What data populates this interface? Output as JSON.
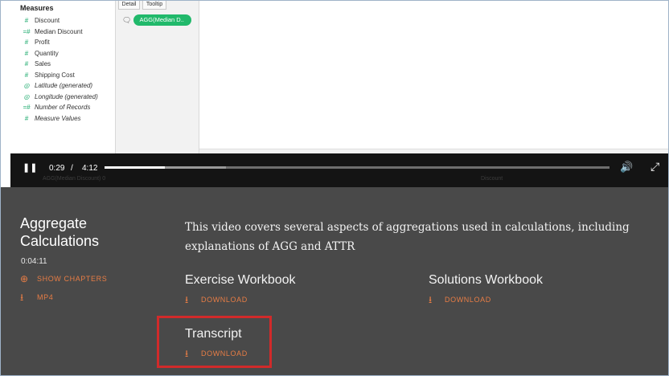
{
  "tableau": {
    "measures_heading": "Measures",
    "measures": [
      {
        "label": "Discount",
        "icon": "#",
        "italic": false
      },
      {
        "label": "Median Discount",
        "icon": "=#",
        "italic": false
      },
      {
        "label": "Profit",
        "icon": "#",
        "italic": false
      },
      {
        "label": "Quantity",
        "icon": "#",
        "italic": false
      },
      {
        "label": "Sales",
        "icon": "#",
        "italic": false
      },
      {
        "label": "Shipping Cost",
        "icon": "#",
        "italic": false
      },
      {
        "label": "Latitude (generated)",
        "icon": "globe",
        "italic": true
      },
      {
        "label": "Longitude (generated)",
        "icon": "globe",
        "italic": true
      },
      {
        "label": "Number of Records",
        "icon": "=#",
        "italic": true
      },
      {
        "label": "Measure Values",
        "icon": "#",
        "italic": true
      }
    ],
    "marks_buttons": [
      "Detail",
      "Tooltip"
    ],
    "pill_label": "AGG(Median D..",
    "bottom_ghost": "AGG(Median Discount) 0",
    "bottom_ghost_right": "Discount"
  },
  "player": {
    "current_time": "0:29",
    "separator": "/",
    "total_time": "4:12",
    "progress_played": 0.12,
    "progress_buffered": 0.24
  },
  "video_info": {
    "title": "Aggregate Calculations",
    "duration": "0:04:11",
    "show_chapters": "SHOW CHAPTERS",
    "mp4": "MP4",
    "description": "This video covers several aspects of aggregations used in calculations, including explanations of AGG and ATTR"
  },
  "resources": {
    "exercise_title": "Exercise Workbook",
    "exercise_download": "DOWNLOAD",
    "solutions_title": "Solutions Workbook",
    "solutions_download": "DOWNLOAD",
    "transcript_title": "Transcript",
    "transcript_download": "DOWNLOAD"
  },
  "colors": {
    "accent": "#e87d45",
    "highlight_box": "#d12a2a",
    "panel_bg": "#494949",
    "pill": "#21b96b"
  }
}
